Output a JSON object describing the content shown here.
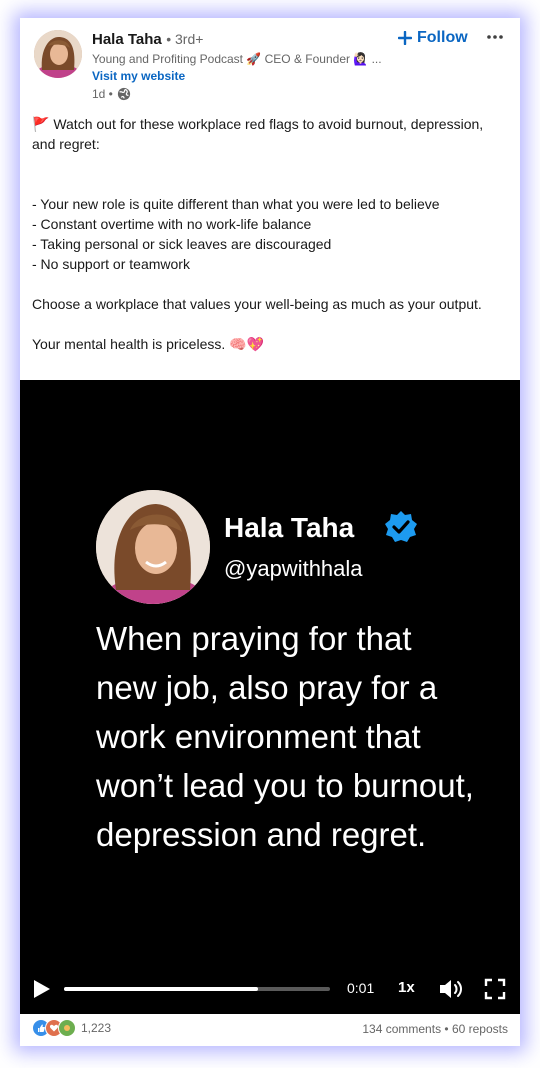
{
  "author": {
    "name": "Hala Taha",
    "degree": "• 3rd+",
    "headline": "Young and Profiting Podcast 🚀 CEO & Founder 🙋🏻‍♀️ ...",
    "website_label": "Visit my website",
    "time": "1d •"
  },
  "actions": {
    "follow_label": "Follow",
    "follow_icon": "plus-icon",
    "more_icon": "ellipsis-icon"
  },
  "post": {
    "lines": [
      "🚩 Watch out for these workplace red flags to avoid burnout, depression, and regret:",
      "- Your new role is quite different than what you were led to believe",
      "- Constant overtime with no work-life balance",
      "- Taking personal or sick leaves are discouraged",
      "- No support or teamwork",
      "Choose a workplace that values your well-being as much as your output.",
      "Your mental health is priceless. 🧠💖"
    ]
  },
  "video": {
    "name": "Hala Taha",
    "handle": "@yapwithhala",
    "quote": "When praying for that new job, also pray for a work environment that won’t lead you to burnout, depression and regret.",
    "time": "0:01",
    "speed": "1x",
    "progress": 0.73
  },
  "footer": {
    "reaction_count": "1,223",
    "comments": "134 comments",
    "separator": "•",
    "reposts": "60 reposts"
  },
  "colors": {
    "brand": "#0a66c2",
    "text": "#191919",
    "muted": "#666666",
    "video_bg": "#000000",
    "verified": "#1d9bf0"
  }
}
